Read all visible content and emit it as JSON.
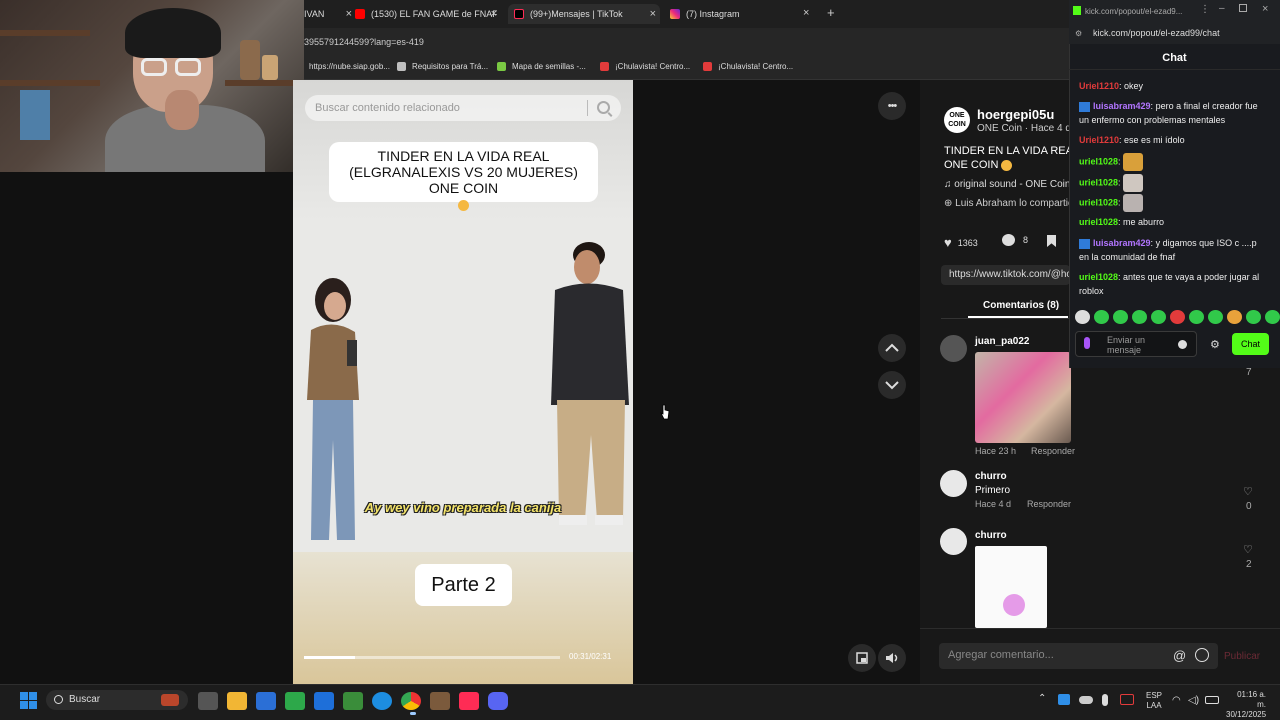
{
  "browser": {
    "tabs": [
      {
        "title": "IVAN",
        "active": false
      },
      {
        "title": "(1530) EL FAN GAME de FNAF",
        "active": false
      },
      {
        "title": "(99+)Mensajes | TikTok",
        "active": true
      },
      {
        "title": "(7) Instagram",
        "active": false
      }
    ],
    "new_tab": "+",
    "close": "×",
    "url_fragment": "3955791244599?lang=es-419",
    "bookmarks": [
      {
        "label": "https://nube.siap.gob...",
        "color": "#ffffff"
      },
      {
        "label": "Requisitos para Trá...",
        "color": "#bfbfbf"
      },
      {
        "label": "Mapa de semillas -...",
        "color": "#7ac943"
      },
      {
        "label": "¡Chulavista! Centro...",
        "color": "#e23b3b"
      },
      {
        "label": "¡Chulavista! Centro...",
        "color": "#e23b3b"
      }
    ]
  },
  "video": {
    "search_placeholder": "Buscar contenido relacionado",
    "title_lines": [
      "TINDER EN LA VIDA REAL",
      "(ELGRANALEXIS VS 20 MUJERES)",
      "ONE COIN"
    ],
    "subtitle": "Ay wey vino preparada la canija",
    "part_label": "Parte 2",
    "time": "00:31/02:31",
    "progress": 0.2,
    "more_icon": "•••"
  },
  "details": {
    "username": "hoergepi05u",
    "meta": "ONE Coin · Hace 4 d",
    "desc_line1": "TINDER EN LA VIDA REAL",
    "desc_line2": "ONE COIN",
    "sound": "original sound - ONE Coin",
    "collab": "Luis Abraham lo compartió",
    "likes": "1363",
    "comments_count": "8",
    "link": "https://www.tiktok.com/@ho",
    "comments_tab": "Comentarios (8)",
    "comment_input_placeholder": "Agregar comentario...",
    "publish": "Publicar",
    "comments": [
      {
        "user": "juan_pa022",
        "text": "",
        "meta": "Hace 23 h",
        "reply": "Responder",
        "likes": "7"
      },
      {
        "user": "churro",
        "text": "Primero",
        "meta": "Hace 4 d",
        "reply": "Responder",
        "likes": "0"
      },
      {
        "user": "churro",
        "text": "",
        "meta": "",
        "reply": "",
        "likes": "2"
      }
    ]
  },
  "kick": {
    "window_title": "kick.com/popout/el-ezad9...",
    "url": "kick.com/popout/el-ezad99/chat",
    "title": "Chat",
    "messages": [
      {
        "user": "Uriel1210",
        "text": "okey",
        "color": "red"
      },
      {
        "user": "luisabram429",
        "text": "pero a final el creador fue un enfermo con problemas mentales",
        "color": "purple"
      },
      {
        "user": "Uriel1210",
        "text": "ese es mi ídolo",
        "color": "red"
      },
      {
        "user": "uriel1028",
        "text": "",
        "color": "green"
      },
      {
        "user": "uriel1028",
        "text": "",
        "color": "green"
      },
      {
        "user": "uriel1028",
        "text": "",
        "color": "green"
      },
      {
        "user": "uriel1028",
        "text": "me aburro",
        "color": "green"
      },
      {
        "user": "luisabram429",
        "text": "y digamos que ISO c ....p en la comunidad de fnaf",
        "color": "purple"
      },
      {
        "user": "uriel1028",
        "text": "antes que te vaya a poder jugar al roblox",
        "color": "green"
      }
    ],
    "send_placeholder": "Enviar un mensaje",
    "chat_button": "Chat"
  },
  "taskbar": {
    "search": "Buscar",
    "lang1": "ESP",
    "lang2": "LAA",
    "time": "01:16 a. m.",
    "date": "30/12/2025"
  },
  "colors": {
    "kick_green": "#53fc18",
    "tiktok_red": "#fe2c55"
  }
}
